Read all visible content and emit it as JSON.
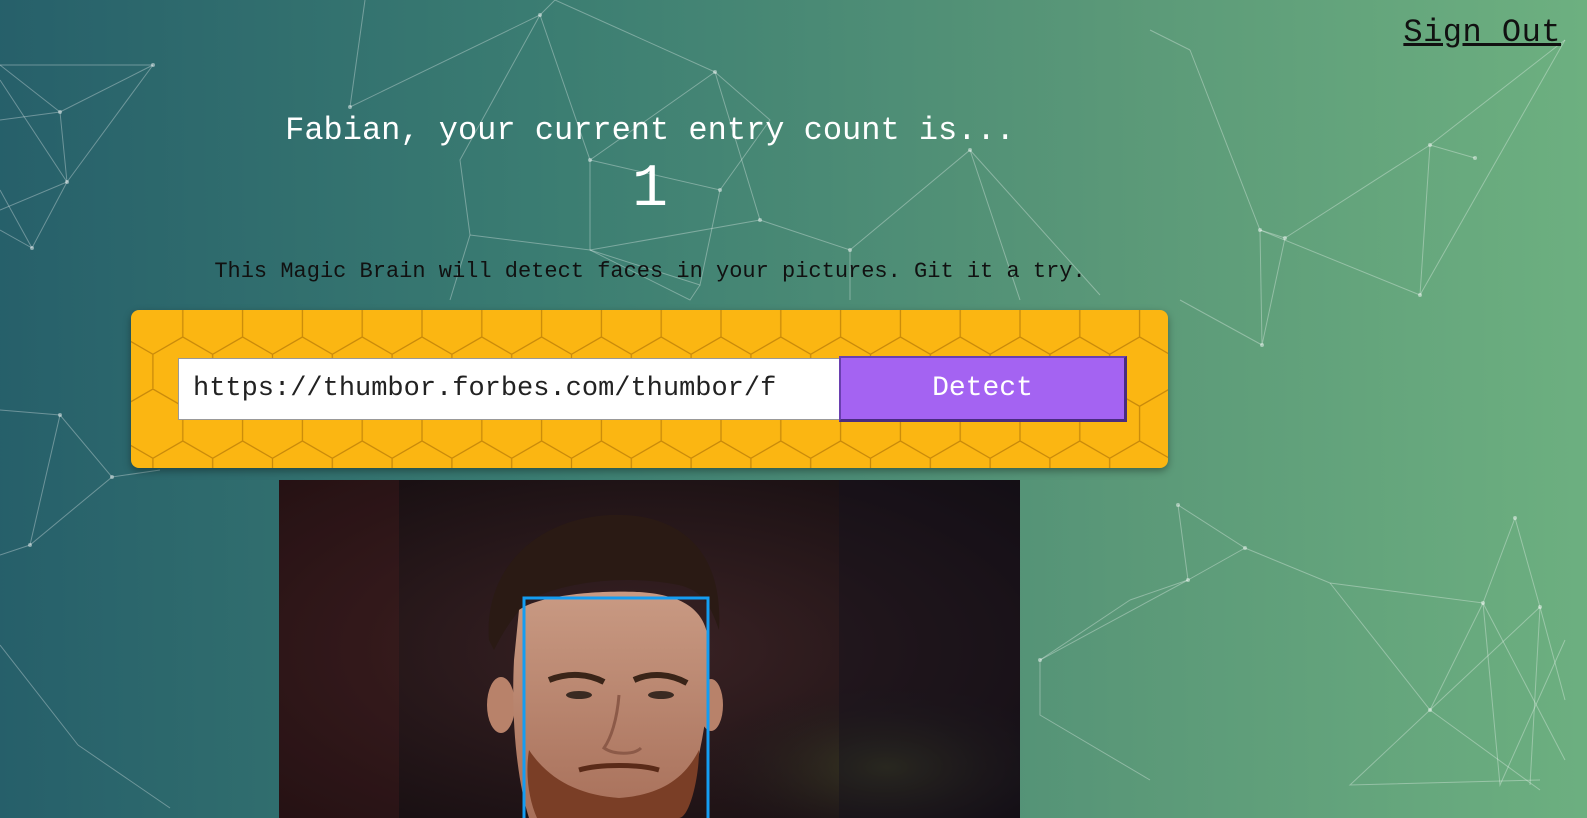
{
  "header": {
    "sign_out_label": "Sign Out"
  },
  "rank": {
    "greeting": "Fabian, your current entry count is...",
    "count": "1"
  },
  "tagline": "This Magic Brain will detect faces in your pictures. Git it a try.",
  "form": {
    "url_value": "https://thumbor.forbes.com/thumbor/f",
    "detect_label": "Detect"
  },
  "colors": {
    "form_background": "#fbb612",
    "button": "#a463f2",
    "face_box": "#149df2"
  }
}
